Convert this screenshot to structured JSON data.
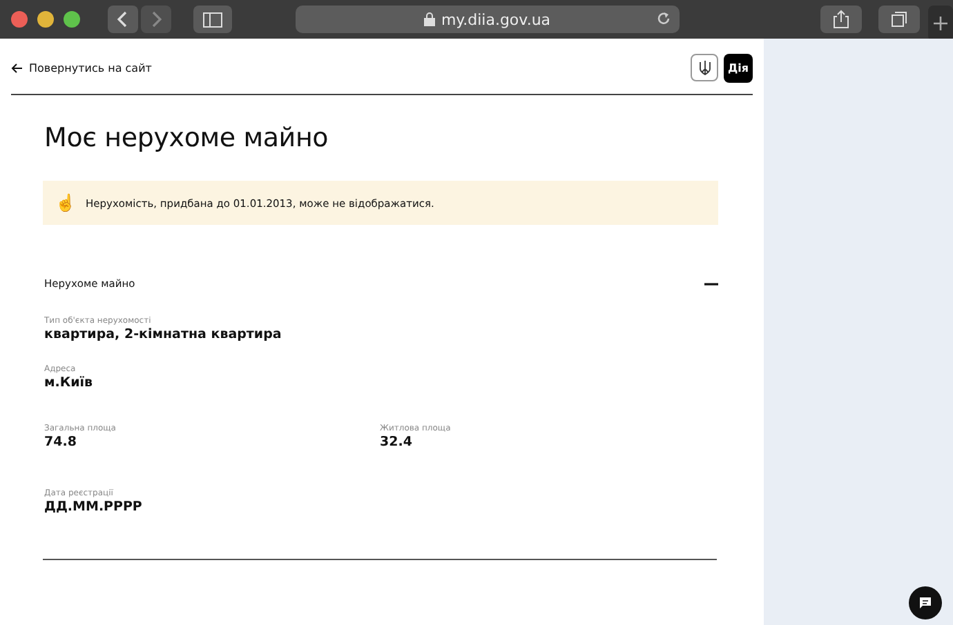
{
  "browser": {
    "url": "my.diia.gov.ua"
  },
  "header": {
    "back_link": "Повернутись на сайт",
    "logo": "Дія"
  },
  "title": "Моє нерухоме майно",
  "notice": {
    "icon": "☝️",
    "text": "Нерухомість, придбана до 01.01.2013, може не відображатися."
  },
  "section": {
    "title": "Нерухоме майно",
    "expanded": true,
    "rows": [
      [
        {
          "label": "Тип об'єкта нерухомості",
          "value": "квартира, 2-кімнатна квартира"
        }
      ],
      [
        {
          "label": "Адреса",
          "value": "м.Київ"
        }
      ],
      [
        {
          "label": "Загальна площа",
          "value": "74.8"
        },
        {
          "label": "Житлова площа",
          "value": "32.4"
        }
      ],
      [
        {
          "label": "Дата реєстрації",
          "value": "ДД.ММ.РРРР"
        }
      ]
    ]
  }
}
